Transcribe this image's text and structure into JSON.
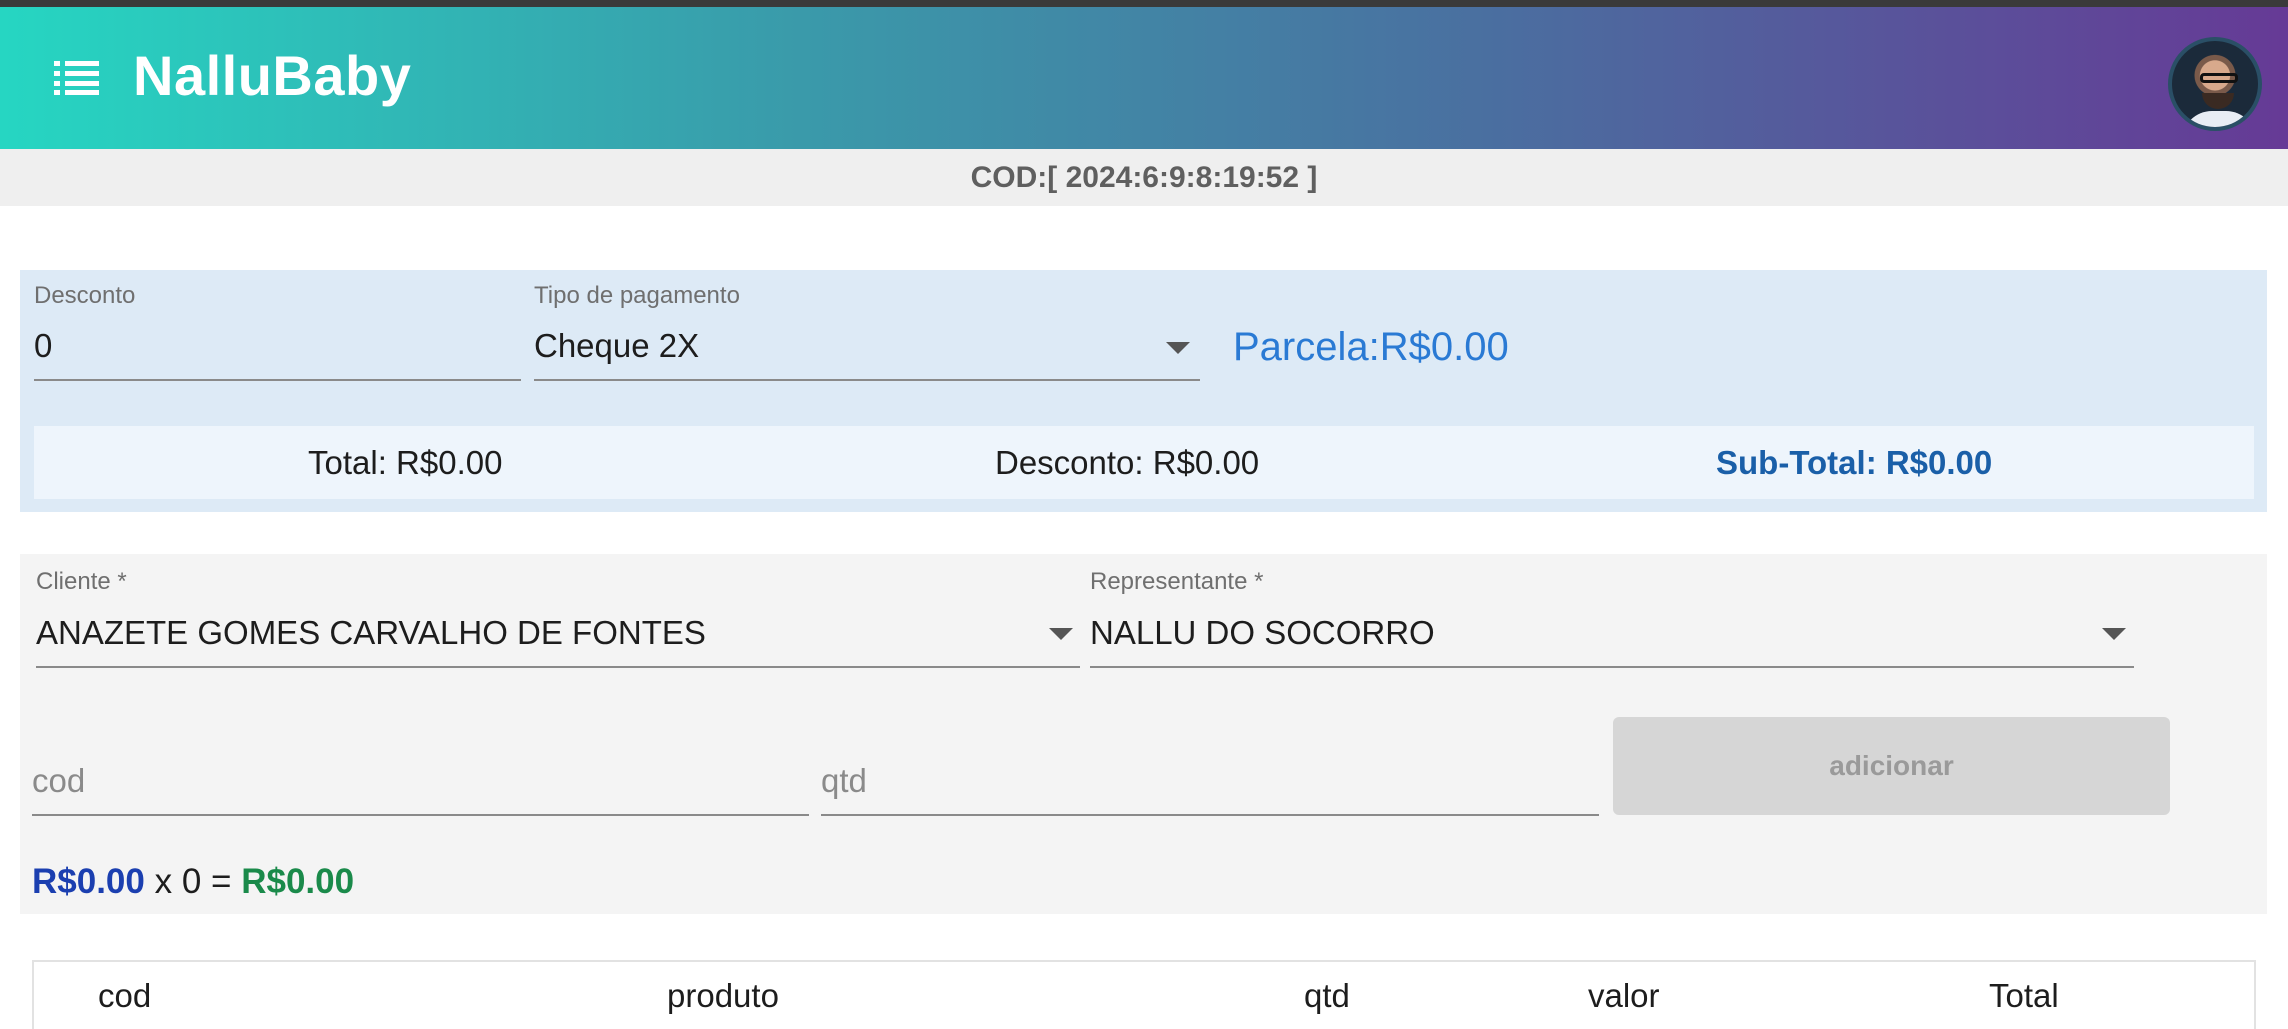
{
  "app": {
    "title": "NalluBaby"
  },
  "header": {
    "menu_icon": "menu-icon",
    "avatar_icon": "user-avatar"
  },
  "order": {
    "code": "COD:[ 2024:6:9:8:19:52 ]"
  },
  "payment": {
    "discount_label": "Desconto",
    "discount_value": "0",
    "type_label": "Tipo de pagamento",
    "type_value": "Cheque 2X",
    "installment": "Parcela:R$0.00"
  },
  "totals": {
    "total": "Total: R$0.00",
    "discount": "Desconto: R$0.00",
    "subtotal": "Sub-Total: R$0.00"
  },
  "client": {
    "client_label": "Cliente *",
    "client_value": "ANAZETE GOMES CARVALHO DE FONTES",
    "rep_label": "Representante *",
    "rep_value": "NALLU DO SOCORRO"
  },
  "item": {
    "cod_placeholder": "cod",
    "qtd_placeholder": "qtd",
    "add_label": "adicionar",
    "price": "R$0.00",
    "multiplier": "x 0 =",
    "line_total": "R$0.00"
  },
  "table": {
    "columns": [
      "cod",
      "produto",
      "qtd",
      "valor",
      "Total"
    ]
  },
  "colors": {
    "gradient_start": "#26d6c2",
    "gradient_end": "#663a96",
    "accent_blue": "#2a7ad4",
    "price_blue": "#1b3fb0",
    "total_green": "#1a8a4a"
  }
}
